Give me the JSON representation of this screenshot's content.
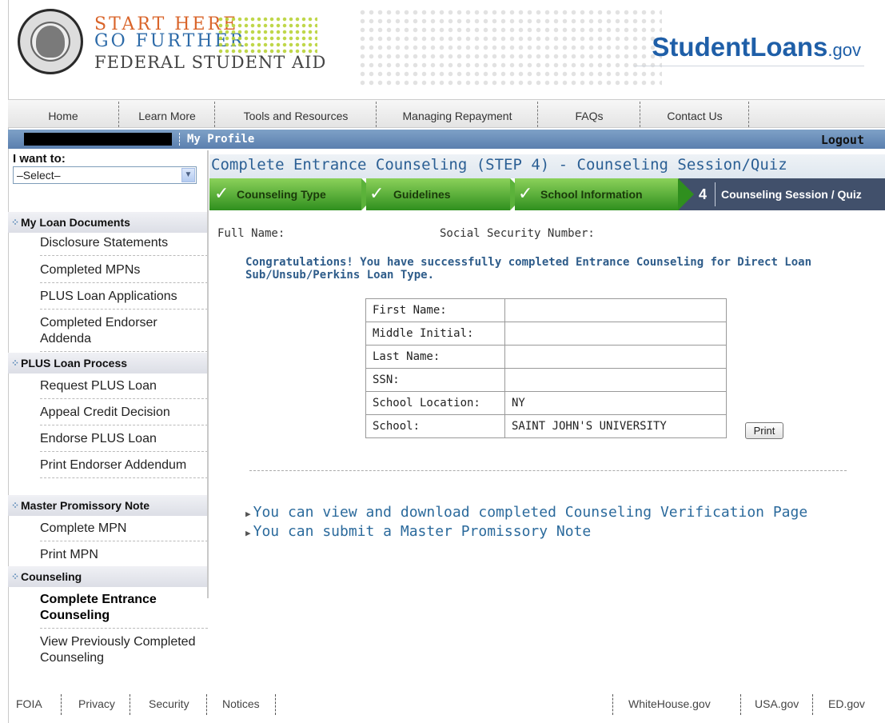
{
  "header": {
    "brand_line1": "START HERE",
    "brand_line2": "GO FURTHER",
    "brand_line3": "FEDERAL STUDENT AID",
    "site_name": "StudentLoans",
    "site_tld": ".gov"
  },
  "nav": {
    "items": [
      "Home",
      "Learn More",
      "Tools and Resources",
      "Managing Repayment",
      "FAQs",
      "Contact Us"
    ]
  },
  "profile_bar": {
    "my_profile": "My Profile",
    "logout": "Logout"
  },
  "sidebar": {
    "iwant_label": "I want to:",
    "select_value": "–Select–",
    "sections": [
      {
        "title": "My Loan Documents",
        "links": [
          "Disclosure Statements",
          "Completed MPNs",
          "PLUS Loan Applications",
          "Completed Endorser Addenda"
        ]
      },
      {
        "title": "PLUS Loan Process",
        "links": [
          "Request PLUS Loan",
          "Appeal Credit Decision",
          "Endorse PLUS Loan",
          "Print Endorser Addendum"
        ]
      },
      {
        "title": "Master Promissory Note",
        "links": [
          "Complete MPN",
          "Print MPN"
        ]
      },
      {
        "title": "Counseling",
        "links": [
          "Complete Entrance Counseling",
          "View Previously Completed Counseling"
        ]
      }
    ]
  },
  "main": {
    "page_title": "Complete Entrance Counseling (STEP 4) - Counseling Session/Quiz",
    "steps": [
      "Counseling Type",
      "Guidelines",
      "School Information",
      "Counseling Session / Quiz"
    ],
    "step4_num": "4",
    "full_name_label": "Full Name:",
    "ssn_label": "Social Security Number:",
    "congrats": "Congratulations! You have successfully completed Entrance Counseling for Direct Loan Sub/Unsub/Perkins Loan Type.",
    "table": [
      {
        "k": "First Name:",
        "v": ""
      },
      {
        "k": "Middle Initial:",
        "v": ""
      },
      {
        "k": "Last Name:",
        "v": ""
      },
      {
        "k": "SSN:",
        "v": ""
      },
      {
        "k": "School Location:",
        "v": "NY"
      },
      {
        "k": "School:",
        "v": "SAINT JOHN'S UNIVERSITY"
      }
    ],
    "print_label": "Print",
    "link_view": "You can view and download completed Counseling Verification Page",
    "link_submit": "You can submit a Master Promissory Note"
  },
  "footer": {
    "left": [
      "FOIA",
      "Privacy",
      "Security",
      "Notices"
    ],
    "right": [
      "WhiteHouse.gov",
      "USA.gov",
      "ED.gov"
    ]
  }
}
